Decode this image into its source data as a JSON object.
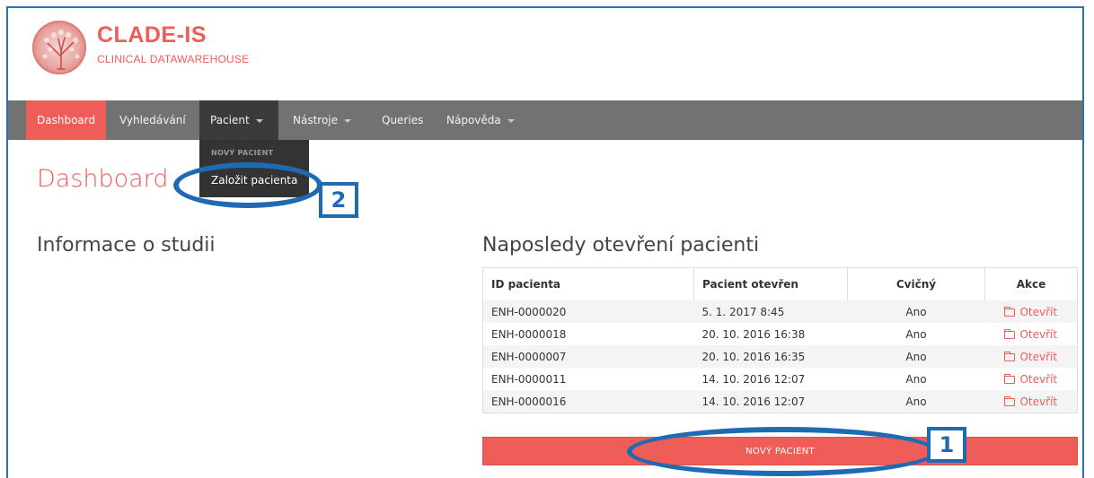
{
  "brand": {
    "title": "CLADE-IS",
    "subtitle": "CLINICAL DATAWAREHOUSE",
    "accent": "#ef5d58"
  },
  "navbar": {
    "items": [
      {
        "label": "Dashboard",
        "active": true
      },
      {
        "label": "Vyhledávání"
      },
      {
        "label": "Pacient",
        "dropdown": true,
        "open": true
      },
      {
        "label": "Nástroje",
        "dropdown": true
      },
      {
        "label": "Queries"
      },
      {
        "label": "Nápověda",
        "dropdown": true
      }
    ]
  },
  "dropdown": {
    "header": "NOVÝ PACIENT",
    "item": "Založit pacienta"
  },
  "page_title": "Dashboard",
  "study_heading": "Informace o studii",
  "recent_heading": "Naposledy otevření pacienti",
  "table": {
    "headers": [
      "ID pacienta",
      "Pacient otevřen",
      "Cvičný",
      "Akce"
    ],
    "rows": [
      {
        "id": "ENH-0000020",
        "opened": "5. 1. 2017 8:45",
        "practice": "Ano",
        "action": "Otevřít"
      },
      {
        "id": "ENH-0000018",
        "opened": "20. 10. 2016 16:38",
        "practice": "Ano",
        "action": "Otevřít"
      },
      {
        "id": "ENH-0000007",
        "opened": "20. 10. 2016 16:35",
        "practice": "Ano",
        "action": "Otevřít"
      },
      {
        "id": "ENH-0000011",
        "opened": "14. 10. 2016 12:07",
        "practice": "Ano",
        "action": "Otevřít"
      },
      {
        "id": "ENH-0000016",
        "opened": "14. 10. 2016 12:07",
        "practice": "Ano",
        "action": "Otevřít"
      }
    ]
  },
  "new_patient_button": "NOVÝ PACIENT",
  "annotations": {
    "badge_1": "1",
    "badge_2": "2",
    "color": "#1f6ab5"
  }
}
